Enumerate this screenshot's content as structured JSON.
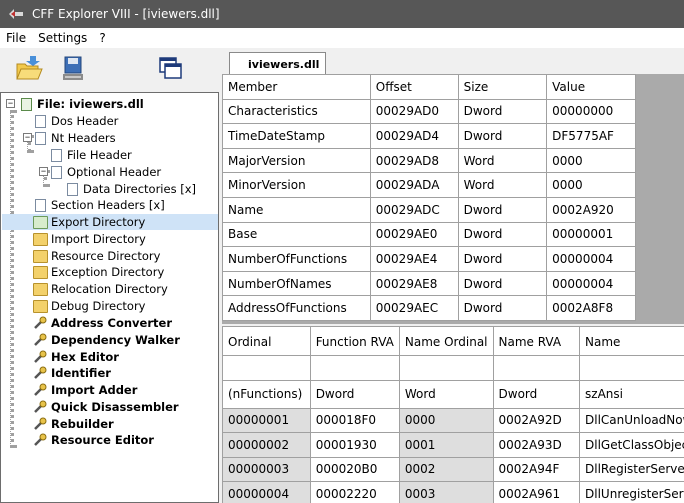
{
  "window": {
    "title": "CFF Explorer VIII - [iviewers.dll]"
  },
  "menu": [
    "File",
    "Settings",
    "?"
  ],
  "toolbar": {
    "icons": [
      "open-file-icon",
      "save-file-icon",
      "windows-icon"
    ]
  },
  "tree": {
    "root": "File: iviewers.dll",
    "items": [
      {
        "label": "Dos Header"
      },
      {
        "label": "Nt Headers"
      },
      {
        "label": "File Header"
      },
      {
        "label": "Optional Header"
      },
      {
        "label": "Data Directories [x]"
      },
      {
        "label": "Section Headers [x]"
      },
      {
        "label": "Export Directory"
      },
      {
        "label": "Import Directory"
      },
      {
        "label": "Resource Directory"
      },
      {
        "label": "Exception Directory"
      },
      {
        "label": "Relocation Directory"
      },
      {
        "label": "Debug Directory"
      },
      {
        "label": "Address Converter"
      },
      {
        "label": "Dependency Walker"
      },
      {
        "label": "Hex Editor"
      },
      {
        "label": "Identifier"
      },
      {
        "label": "Import Adder"
      },
      {
        "label": "Quick Disassembler"
      },
      {
        "label": "Rebuilder"
      },
      {
        "label": "Resource Editor"
      }
    ]
  },
  "tab": {
    "label": "iviewers.dll"
  },
  "header_table": {
    "columns": [
      "Member",
      "Offset",
      "Size",
      "Value"
    ],
    "rows": [
      [
        "Characteristics",
        "00029AD0",
        "Dword",
        "00000000"
      ],
      [
        "TimeDateStamp",
        "00029AD4",
        "Dword",
        "DF5775AF"
      ],
      [
        "MajorVersion",
        "00029AD8",
        "Word",
        "0000"
      ],
      [
        "MinorVersion",
        "00029ADA",
        "Word",
        "0000"
      ],
      [
        "Name",
        "00029ADC",
        "Dword",
        "0002A920"
      ],
      [
        "Base",
        "00029AE0",
        "Dword",
        "00000001"
      ],
      [
        "NumberOfFunctions",
        "00029AE4",
        "Dword",
        "00000004"
      ],
      [
        "NumberOfNames",
        "00029AE8",
        "Dword",
        "00000004"
      ],
      [
        "AddressOfFunctions",
        "00029AEC",
        "Dword",
        "0002A8F8"
      ]
    ]
  },
  "functions_table": {
    "columns": [
      "Ordinal",
      "Function RVA",
      "Name Ordinal",
      "Name RVA",
      "Name"
    ],
    "type_row": [
      "(nFunctions)",
      "Dword",
      "Word",
      "Dword",
      "szAnsi"
    ],
    "rows": [
      [
        "00000001",
        "000018F0",
        "0000",
        "0002A92D",
        "DllCanUnloadNow"
      ],
      [
        "00000002",
        "00001930",
        "0001",
        "0002A93D",
        "DllGetClassObject"
      ],
      [
        "00000003",
        "000020B0",
        "0002",
        "0002A94F",
        "DllRegisterServer"
      ],
      [
        "00000004",
        "00002220",
        "0003",
        "0002A961",
        "DllUnregisterServer"
      ]
    ]
  }
}
